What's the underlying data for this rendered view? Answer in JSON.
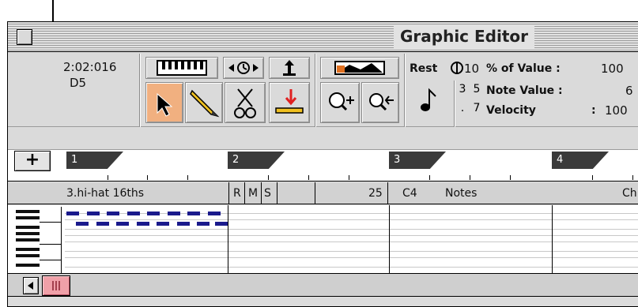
{
  "window": {
    "title": "Graphic Editor"
  },
  "toolbar": {
    "position": "2:02:016",
    "pitch": "D5",
    "rest_label": "Rest",
    "field_10": "10",
    "field_3": "3",
    "field_5": "5",
    "field_dot": ".",
    "field_7": "7",
    "percent_label": "% of Value :",
    "percent_value": "100",
    "note_value_label": "Note Value :",
    "note_value": "6",
    "velocity_label": "Velocity",
    "velocity_sep": ":",
    "velocity_value": "100"
  },
  "ruler": {
    "add_button": "+",
    "bars": [
      "1",
      "2",
      "3",
      "4"
    ]
  },
  "track": {
    "name": "3.hi-hat 16ths",
    "r": "R",
    "m": "M",
    "s": "S",
    "number": "25",
    "note": "C4",
    "type": "Notes",
    "channel_partial": "Ch"
  },
  "colors": {
    "notes": "#1a1a8c",
    "active_tool": "#f1b080",
    "scroll_thumb": "#f0a0a8"
  }
}
